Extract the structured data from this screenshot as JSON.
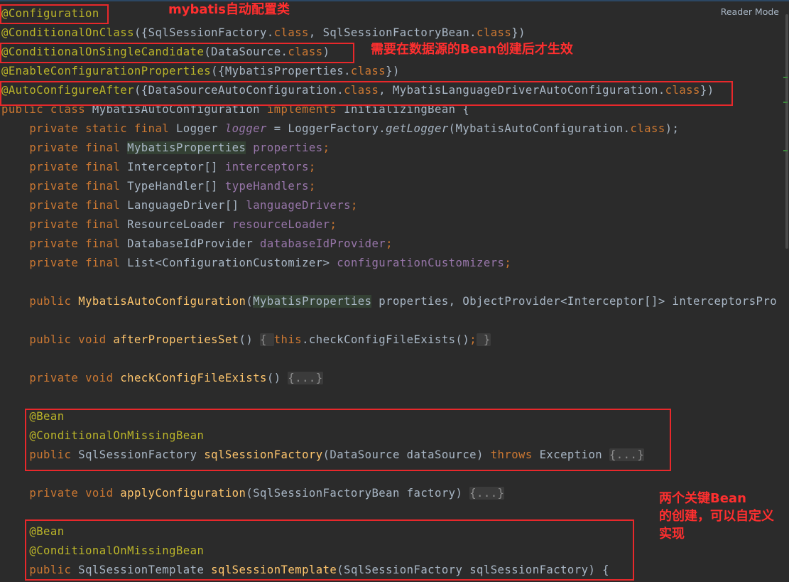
{
  "reader_mode": "Reader Mode",
  "code_lines": [
    [
      [
        "t-ann",
        "@Configuration"
      ]
    ],
    [
      [
        "t-ann",
        "@ConditionalOnClass"
      ],
      [
        "t-txt",
        "({SqlSessionFactory."
      ],
      [
        "t-kw",
        "class"
      ],
      [
        "t-txt",
        ", SqlSessionFactoryBean."
      ],
      [
        "t-kw",
        "class"
      ],
      [
        "t-txt",
        "})"
      ]
    ],
    [
      [
        "t-ann",
        "@ConditionalOnSingleCandidate"
      ],
      [
        "t-txt",
        "(DataSource."
      ],
      [
        "t-kw",
        "class"
      ],
      [
        "t-txt",
        ")"
      ]
    ],
    [
      [
        "t-ann",
        "@EnableConfigurationProperties"
      ],
      [
        "t-txt",
        "({MybatisProperties."
      ],
      [
        "t-kw",
        "class"
      ],
      [
        "t-txt",
        "})"
      ]
    ],
    [
      [
        "t-ann",
        "@AutoConfigureAfter"
      ],
      [
        "t-txt",
        "({DataSourceAutoConfiguration."
      ],
      [
        "t-kw",
        "class"
      ],
      [
        "t-txt",
        ", MybatisLanguageDriverAutoConfiguration."
      ],
      [
        "t-kw",
        "class"
      ],
      [
        "t-txt",
        "})"
      ]
    ],
    [
      [
        "t-kw",
        "public class "
      ],
      [
        "t-txt",
        "MybatisAutoConfiguration "
      ],
      [
        "t-kw",
        "implements "
      ],
      [
        "t-txt",
        "InitializingBean {"
      ]
    ],
    [
      [
        "t-txt",
        "    "
      ],
      [
        "t-kw",
        "private static final "
      ],
      [
        "t-txt",
        "Logger "
      ],
      [
        "t-it",
        "logger"
      ],
      [
        "t-txt",
        " = LoggerFactory."
      ],
      [
        "t-itc",
        "getLogger"
      ],
      [
        "t-txt",
        "(MybatisAutoConfiguration."
      ],
      [
        "t-kw",
        "class"
      ],
      [
        "t-txt",
        ");"
      ]
    ],
    [
      [
        "t-txt",
        "    "
      ],
      [
        "t-kw",
        "private final "
      ],
      [
        "t-hl",
        "MybatisProperties"
      ],
      [
        "t-txt",
        " "
      ],
      [
        "t-fld",
        "properties"
      ],
      [
        "t-kw",
        ";"
      ]
    ],
    [
      [
        "t-txt",
        "    "
      ],
      [
        "t-kw",
        "private final "
      ],
      [
        "t-txt",
        "Interceptor[] "
      ],
      [
        "t-fld",
        "interceptors"
      ],
      [
        "t-kw",
        ";"
      ]
    ],
    [
      [
        "t-txt",
        "    "
      ],
      [
        "t-kw",
        "private final "
      ],
      [
        "t-txt",
        "TypeHandler[] "
      ],
      [
        "t-fld",
        "typeHandlers"
      ],
      [
        "t-kw",
        ";"
      ]
    ],
    [
      [
        "t-txt",
        "    "
      ],
      [
        "t-kw",
        "private final "
      ],
      [
        "t-txt",
        "LanguageDriver[] "
      ],
      [
        "t-fld",
        "languageDrivers"
      ],
      [
        "t-kw",
        ";"
      ]
    ],
    [
      [
        "t-txt",
        "    "
      ],
      [
        "t-kw",
        "private final "
      ],
      [
        "t-txt",
        "ResourceLoader "
      ],
      [
        "t-fld",
        "resourceLoader"
      ],
      [
        "t-kw",
        ";"
      ]
    ],
    [
      [
        "t-txt",
        "    "
      ],
      [
        "t-kw",
        "private final "
      ],
      [
        "t-txt",
        "DatabaseIdProvider "
      ],
      [
        "t-fld",
        "databaseIdProvider"
      ],
      [
        "t-kw",
        ";"
      ]
    ],
    [
      [
        "t-txt",
        "    "
      ],
      [
        "t-kw",
        "private final "
      ],
      [
        "t-txt",
        "List<ConfigurationCustomizer> "
      ],
      [
        "t-fld",
        "configurationCustomizers"
      ],
      [
        "t-kw",
        ";"
      ]
    ],
    [],
    [
      [
        "t-txt",
        "    "
      ],
      [
        "t-kw",
        "public "
      ],
      [
        "t-fn",
        "MybatisAutoConfiguration"
      ],
      [
        "t-txt",
        "("
      ],
      [
        "t-hl",
        "MybatisProperties"
      ],
      [
        "t-txt",
        " properties, ObjectProvider<Interceptor[]> interceptorsPro"
      ]
    ],
    [],
    [
      [
        "t-txt",
        "    "
      ],
      [
        "t-kw",
        "public void "
      ],
      [
        "t-fn",
        "afterPropertiesSet"
      ],
      [
        "t-txt",
        "() "
      ],
      [
        "t-fold",
        "{ "
      ],
      [
        "t-kw",
        "this"
      ],
      [
        "t-txt",
        ".checkConfigFileExists()"
      ],
      [
        "t-kw",
        ";"
      ],
      [
        "t-fold",
        " }"
      ]
    ],
    [],
    [
      [
        "t-txt",
        "    "
      ],
      [
        "t-kw",
        "private void "
      ],
      [
        "t-fn",
        "checkConfigFileExists"
      ],
      [
        "t-txt",
        "() "
      ],
      [
        "t-fold",
        "{...}"
      ]
    ],
    [],
    [
      [
        "t-txt",
        "    "
      ],
      [
        "t-ann",
        "@Bean"
      ]
    ],
    [
      [
        "t-txt",
        "    "
      ],
      [
        "t-ann",
        "@ConditionalOnMissingBean"
      ]
    ],
    [
      [
        "t-txt",
        "    "
      ],
      [
        "t-kw",
        "public "
      ],
      [
        "t-txt",
        "SqlSessionFactory "
      ],
      [
        "t-fn",
        "sqlSessionFactory"
      ],
      [
        "t-txt",
        "(DataSource dataSource) "
      ],
      [
        "t-kw",
        "throws "
      ],
      [
        "t-txt",
        "Exception "
      ],
      [
        "t-fold",
        "{...}"
      ]
    ],
    [],
    [
      [
        "t-txt",
        "    "
      ],
      [
        "t-kw",
        "private void "
      ],
      [
        "t-fn",
        "applyConfiguration"
      ],
      [
        "t-txt",
        "(SqlSessionFactoryBean factory) "
      ],
      [
        "t-fold",
        "{...}"
      ]
    ],
    [],
    [
      [
        "t-txt",
        "    "
      ],
      [
        "t-ann",
        "@Bean"
      ]
    ],
    [
      [
        "t-txt",
        "    "
      ],
      [
        "t-ann",
        "@ConditionalOnMissingBean"
      ]
    ],
    [
      [
        "t-txt",
        "    "
      ],
      [
        "t-kw",
        "public "
      ],
      [
        "t-txt",
        "SqlSessionTemplate "
      ],
      [
        "t-fn",
        "sqlSessionTemplate"
      ],
      [
        "t-txt",
        "(SqlSessionFactory sqlSessionFactory) {"
      ]
    ]
  ],
  "notes": {
    "config_class": "mybatis自动配置类",
    "after_datasource": "需要在数据源的Bean创建后才生效",
    "custom_beans": "两个关键Bean\n的创建，可以自定义\n实现"
  }
}
